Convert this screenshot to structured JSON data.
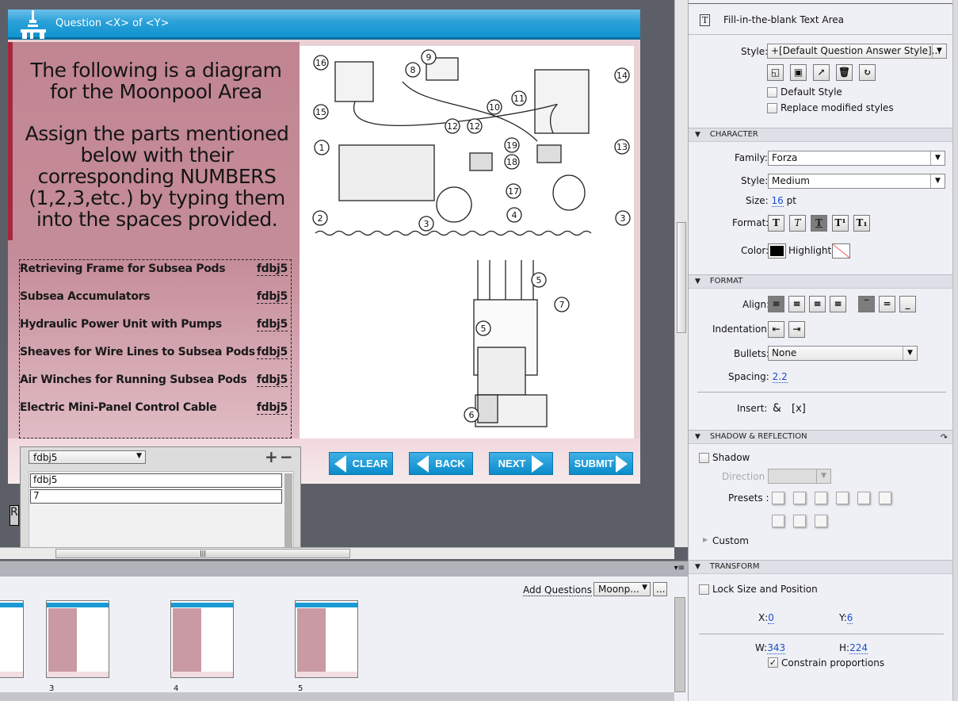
{
  "slide": {
    "header_title": "Question <X> of <Y>",
    "question_line1": "The following is a diagram for the Moonpool Area",
    "question_line2": "Assign the parts mentioned below with their corresponding NUMBERS (1,2,3,etc.) by typing them into the spaces provided.",
    "answers": [
      {
        "label": "Retrieving Frame for Subsea Pods",
        "blank": "fdbj5"
      },
      {
        "label": "Subsea Accumulators",
        "blank": "fdbj5"
      },
      {
        "label": "Hydraulic Power Unit with Pumps",
        "blank": "fdbj5"
      },
      {
        "label": "Sheaves for Wire Lines to Subsea Pods",
        "blank": "fdbj5"
      },
      {
        "label": "Air Winches for Running Subsea Pods",
        "blank": "fdbj5"
      },
      {
        "label": "Electric Mini-Panel Control Cable",
        "blank": "fdbj5"
      }
    ],
    "diagram_labels": [
      "1",
      "2",
      "3",
      "3",
      "4",
      "5",
      "5",
      "6",
      "7",
      "8",
      "9",
      "10",
      "11",
      "12",
      "12",
      "13",
      "14",
      "15",
      "16",
      "17",
      "18",
      "19"
    ],
    "buttons": {
      "clear": "CLEAR",
      "back": "BACK",
      "next": "NEXT",
      "submit": "SUBMIT"
    }
  },
  "answer_popup": {
    "selected": "fdbj5",
    "entries": [
      "fdbj5",
      "7"
    ]
  },
  "filmstrip": {
    "add_questions": "Add Questions",
    "pool_select": "Moonp...",
    "more_button": "...",
    "slide_numbers": [
      "3",
      "4",
      "5"
    ]
  },
  "properties": {
    "object_type": "Fill-in-the-blank Text Area",
    "style_label": "Style:",
    "style_value": "+[Default Question Answer Style]...",
    "default_style": "Default Style",
    "replace_modified": "Replace modified styles",
    "character": {
      "title": "CHARACTER",
      "family_label": "Family:",
      "family": "Forza",
      "style_label": "Style:",
      "style": "Medium",
      "size_label": "Size:",
      "size": "16",
      "size_unit": "pt",
      "format_label": "Format:",
      "color_label": "Color:",
      "color": "#000000",
      "highlight_label": "Highlight:"
    },
    "format": {
      "title": "FORMAT",
      "align_label": "Align:",
      "indentation_label": "Indentation:",
      "bullets_label": "Bullets:",
      "bullets": "None",
      "spacing_label": "Spacing:",
      "spacing": "2.2",
      "insert_label": "Insert:",
      "insert_symbol": "&",
      "insert_variable": "[x]"
    },
    "shadow": {
      "title": "SHADOW & REFLECTION",
      "shadow_label": "Shadow",
      "direction_label": "Direction :",
      "presets_label": "Presets :",
      "custom_label": "Custom"
    },
    "transform": {
      "title": "TRANSFORM",
      "lock_label": "Lock Size and Position",
      "x_label": "X:",
      "x": "0",
      "y_label": "Y:",
      "y": "6",
      "w_label": "W:",
      "w": "343",
      "h_label": "H:",
      "h": "224",
      "constrain_label": "Constrain proportions",
      "constrain_checked": true
    }
  },
  "colors": {
    "header_blue": "#1a9ad4",
    "slide_pink": "#c58d99",
    "link_blue": "#1a4fc9"
  }
}
